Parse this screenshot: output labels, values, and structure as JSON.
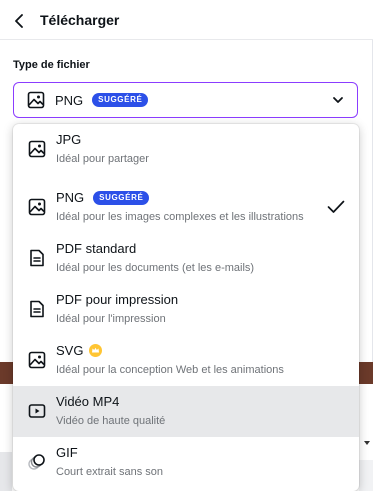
{
  "header": {
    "title": "Télécharger"
  },
  "file_type": {
    "label": "Type de fichier",
    "selected_value": "PNG",
    "selected_badge": "SUGGÉRÉ"
  },
  "options": [
    {
      "title": "JPG",
      "subtitle": "Idéal pour partager",
      "icon": "image-icon"
    },
    {
      "title": "PNG",
      "badge": "SUGGÉRÉ",
      "subtitle": "Idéal pour les images complexes et les illustrations",
      "icon": "image-icon",
      "checked": true
    },
    {
      "title": "PDF standard",
      "subtitle": "Idéal pour les documents (et les e-mails)",
      "icon": "document-icon"
    },
    {
      "title": "PDF pour impression",
      "subtitle": "Idéal pour l'impression",
      "icon": "document-icon"
    },
    {
      "title": "SVG",
      "subtitle": "Idéal pour la conception Web et les animations",
      "icon": "image-icon",
      "premium": true
    },
    {
      "title": "Vidéo MP4",
      "subtitle": "Vidéo de haute qualité",
      "icon": "video-icon",
      "hovered": true
    },
    {
      "title": "GIF",
      "subtitle": "Court extrait sans son",
      "icon": "gif-icon"
    }
  ],
  "colors": {
    "accent": "#8b3dff",
    "badge": "#2c50e8",
    "hover": "#e7e8ea",
    "crown": "#ffc533"
  }
}
